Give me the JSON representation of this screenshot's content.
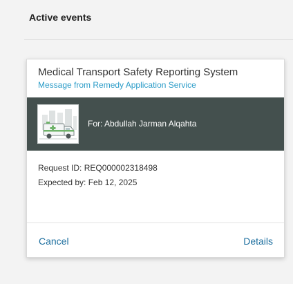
{
  "section": {
    "title": "Active events"
  },
  "card": {
    "title": "Medical Transport Safety Reporting System",
    "subtitle": "Message from Remedy Application Service",
    "thumbnail_icon": "ambulance-illustration-icon",
    "for_text": "For: Abdullah Jarman Alqahta",
    "request_id_text": "Request ID: REQ000002318498",
    "expected_by_text": "Expected by: Feb 12, 2025",
    "actions": {
      "cancel_label": "Cancel",
      "details_label": "Details"
    }
  },
  "colors": {
    "banner": "#44504e",
    "link": "#1d6f9f",
    "subtitle": "#2b9cc8",
    "background": "#f3f3f3"
  }
}
